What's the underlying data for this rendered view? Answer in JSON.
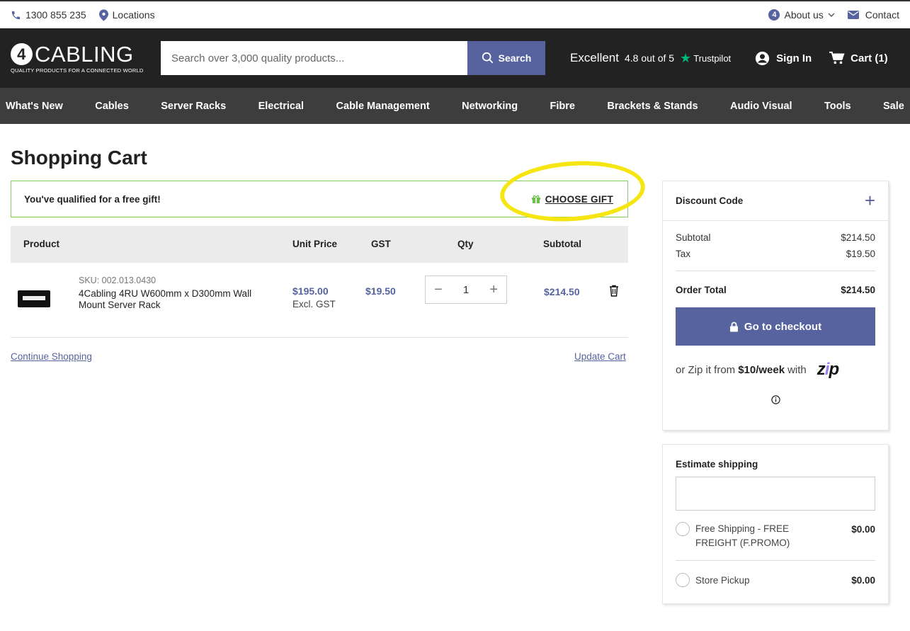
{
  "topbar": {
    "phone": "1300 855 235",
    "locations": "Locations",
    "about": "About us",
    "contact": "Contact"
  },
  "header": {
    "logo_text": "CABLING",
    "logo_badge": "4",
    "logo_tagline": "QUALITY PRODUCTS FOR A CONNECTED WORLD",
    "search_placeholder": "Search over 3,000 quality products...",
    "search_label": "Search",
    "rating_word": "Excellent",
    "rating_score": "4.8 out of 5",
    "rating_brand": "Trustpilot",
    "signin": "Sign In",
    "cart": "Cart (1)"
  },
  "nav": {
    "items": [
      "What's New",
      "Cables",
      "Server Racks",
      "Electrical",
      "Cable Management",
      "Networking",
      "Fibre",
      "Brackets & Stands",
      "Audio Visual",
      "Tools",
      "Sale"
    ]
  },
  "page": {
    "title": "Shopping Cart"
  },
  "gift": {
    "message": "You've qualified for a free gift!",
    "action": "CHOOSE GIFT"
  },
  "table": {
    "headers": {
      "product": "Product",
      "unit_price": "Unit Price",
      "gst": "GST",
      "qty": "Qty",
      "subtotal": "Subtotal"
    },
    "items": [
      {
        "sku": "SKU: 002.013.0430",
        "name": "4Cabling 4RU W600mm x D300mm Wall Mount Server Rack",
        "unit_price": "$195.00",
        "excl": "Excl. GST",
        "gst": "$19.50",
        "qty": "1",
        "subtotal": "$214.50"
      }
    ]
  },
  "links": {
    "continue": "Continue Shopping",
    "update": "Update Cart"
  },
  "summary": {
    "discount_label": "Discount Code",
    "subtotal_label": "Subtotal",
    "subtotal_value": "$214.50",
    "tax_label": "Tax",
    "tax_value": "$19.50",
    "total_label": "Order Total",
    "total_value": "$214.50",
    "checkout_label": "Go to checkout",
    "zip_prefix": "or Zip it from",
    "zip_amount": "$10/week",
    "zip_suffix": "with",
    "zip_logo_a": "z",
    "zip_logo_b": "i",
    "zip_logo_c": "p"
  },
  "shipping": {
    "title": "Estimate shipping",
    "options": [
      {
        "label": "Free Shipping - FREE FREIGHT (F.PROMO)",
        "price": "$0.00"
      },
      {
        "label": "Store Pickup",
        "price": "$0.00"
      }
    ]
  },
  "colors": {
    "accent": "#56639f",
    "header_bg": "#222222",
    "nav_bg": "#3d3d3d",
    "gift_border": "#7fcf5c",
    "highlight": "#f5e510",
    "trustpilot": "#00b67a"
  }
}
